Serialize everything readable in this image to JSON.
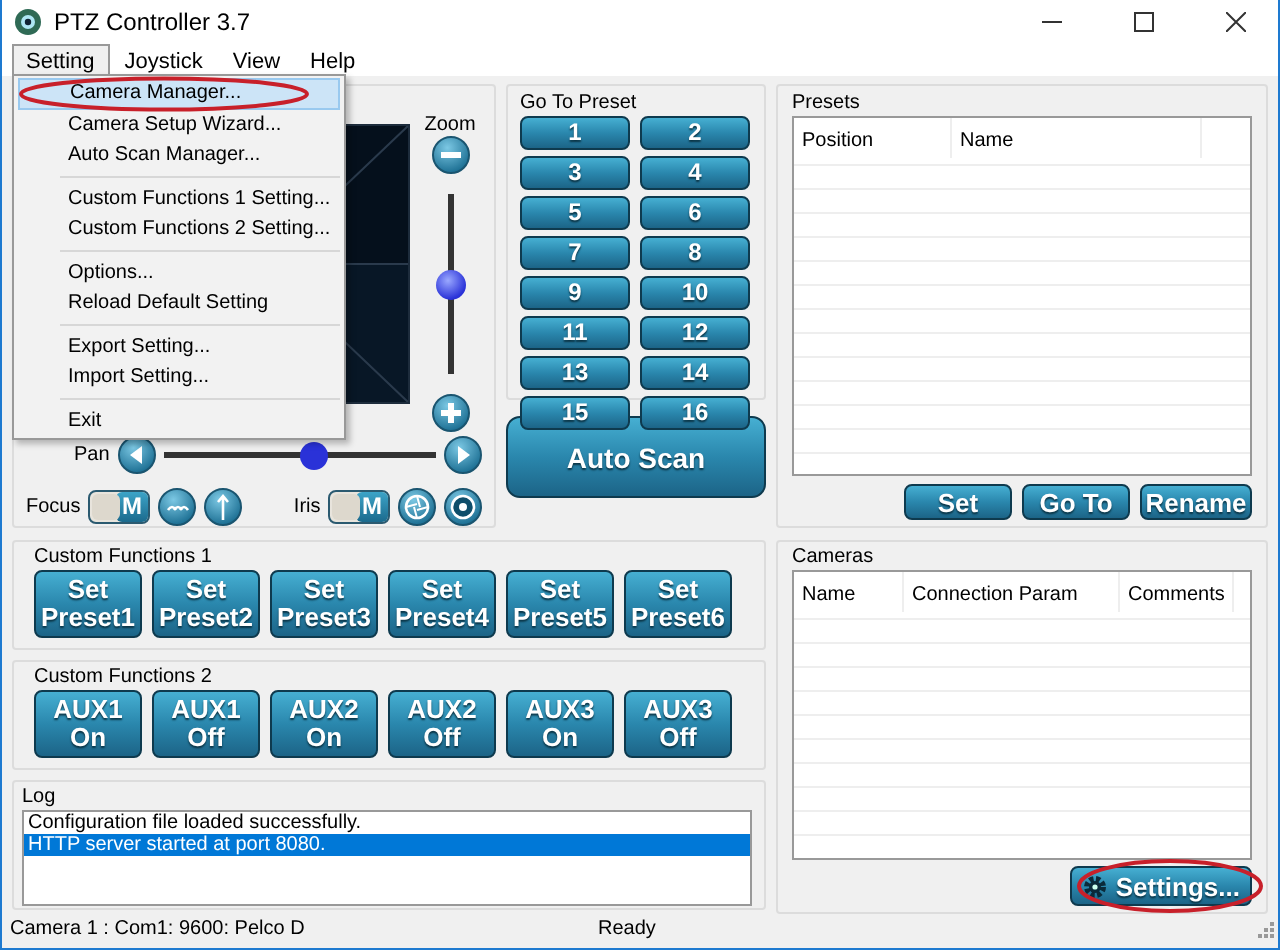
{
  "window": {
    "title": "PTZ Controller 3.7"
  },
  "menu_bar": [
    {
      "label": "Setting",
      "selected": true
    },
    {
      "label": "Joystick",
      "selected": false
    },
    {
      "label": "View",
      "selected": false
    },
    {
      "label": "Help",
      "selected": false
    }
  ],
  "open_menu": {
    "items": [
      {
        "kind": "item",
        "label": "Camera Manager...",
        "selected": true,
        "circled": true
      },
      {
        "kind": "item",
        "label": "Camera Setup Wizard...",
        "selected": false,
        "circled": false
      },
      {
        "kind": "item",
        "label": "Auto Scan Manager...",
        "selected": false,
        "circled": false
      },
      {
        "kind": "separator"
      },
      {
        "kind": "item",
        "label": "Custom Functions 1 Setting...",
        "selected": false,
        "circled": false
      },
      {
        "kind": "item",
        "label": "Custom Functions 2 Setting...",
        "selected": false,
        "circled": false
      },
      {
        "kind": "separator"
      },
      {
        "kind": "item",
        "label": "Options...",
        "selected": false,
        "circled": false
      },
      {
        "kind": "item",
        "label": "Reload Default Setting",
        "selected": false,
        "circled": false
      },
      {
        "kind": "separator"
      },
      {
        "kind": "item",
        "label": "Export Setting...",
        "selected": false,
        "circled": false
      },
      {
        "kind": "item",
        "label": "Import Setting...",
        "selected": false,
        "circled": false
      },
      {
        "kind": "separator"
      },
      {
        "kind": "item",
        "label": "Exit",
        "selected": false,
        "circled": false
      }
    ]
  },
  "ptz": {
    "pan_label": "Pan",
    "pan": {
      "level": 0.5
    },
    "zoom_label": "Zoom",
    "zoom": {
      "level": 0.5
    },
    "focus": {
      "label": "Focus",
      "switch": "M",
      "on": true
    },
    "iris": {
      "label": "Iris",
      "switch": "M",
      "on": true
    }
  },
  "go_to_preset": {
    "title": "Go To Preset",
    "buttons": [
      "1",
      "2",
      "3",
      "4",
      "5",
      "6",
      "7",
      "8",
      "9",
      "10",
      "11",
      "12",
      "13",
      "14",
      "15",
      "16"
    ]
  },
  "auto_scan": "Auto Scan",
  "presets": {
    "title": "Presets",
    "columns": [
      "Position",
      "Name"
    ],
    "buttons": [
      "Set",
      "Go To",
      "Rename"
    ]
  },
  "custom_functions_1": {
    "title": "Custom Functions 1",
    "buttons": [
      {
        "lines": [
          "Set",
          "Preset1"
        ]
      },
      {
        "lines": [
          "Set",
          "Preset2"
        ]
      },
      {
        "lines": [
          "Set",
          "Preset3"
        ]
      },
      {
        "lines": [
          "Set",
          "Preset4"
        ]
      },
      {
        "lines": [
          "Set",
          "Preset5"
        ]
      },
      {
        "lines": [
          "Set",
          "Preset6"
        ]
      }
    ]
  },
  "custom_functions_2": {
    "title": "Custom Functions 2",
    "buttons": [
      {
        "lines": [
          "AUX1",
          "On"
        ]
      },
      {
        "lines": [
          "AUX1",
          "Off"
        ]
      },
      {
        "lines": [
          "AUX2",
          "On"
        ]
      },
      {
        "lines": [
          "AUX2",
          "Off"
        ]
      },
      {
        "lines": [
          "AUX3",
          "On"
        ]
      },
      {
        "lines": [
          "AUX3",
          "Off"
        ]
      }
    ]
  },
  "log": {
    "title": "Log",
    "lines": [
      {
        "text": "Configuration file loaded successfully.",
        "selected": false
      },
      {
        "text": "HTTP server started at port 8080.",
        "selected": true
      }
    ]
  },
  "cameras": {
    "title": "Cameras",
    "columns": [
      "Name",
      "Connection Param",
      "Comments"
    ],
    "settings_button": {
      "label": "Settings...",
      "circled": true
    }
  },
  "status_bar": {
    "connection": "Camera 1 : Com1: 9600: Pelco D",
    "state": "Ready"
  }
}
